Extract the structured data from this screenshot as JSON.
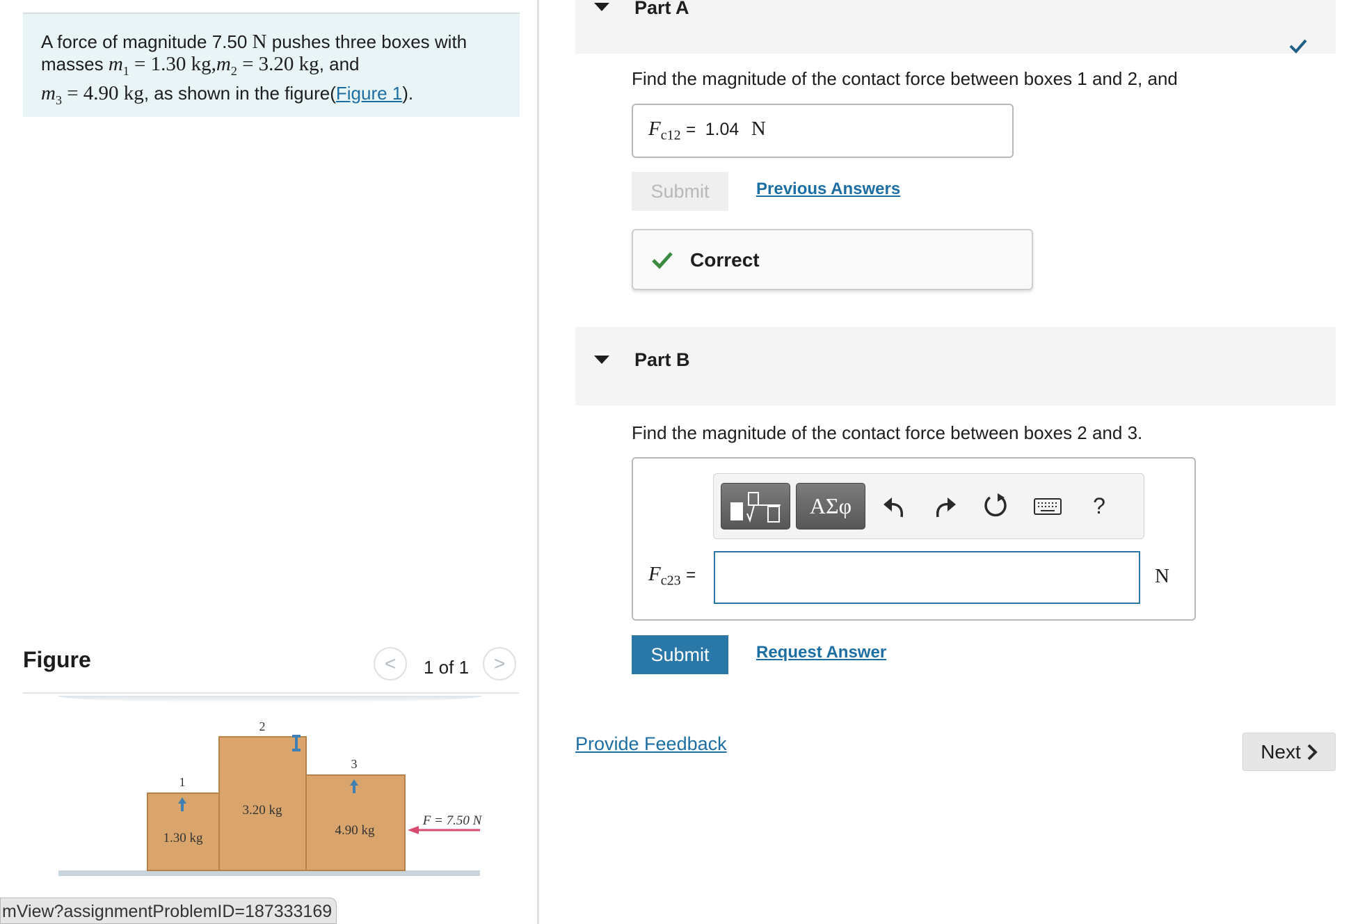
{
  "problem": {
    "text_1": "A force of magnitude 7.50",
    "force_unit": "N",
    "text_2": "pushes three boxes with",
    "masses_word": "masses",
    "m1_sym": "m",
    "m1_sub": "1",
    "m1_eq": "= 1.30  kg,",
    "m2_sym": "m",
    "m2_sub": "2",
    "m2_eq": "= 3.20 kg",
    "and_word": ", and",
    "m3_sym": "m",
    "m3_sub": "3",
    "m3_eq": "= 4.90 kg",
    "text_3": ", as shown in the figure(",
    "figure_link": "Figure 1",
    "text_4": ")."
  },
  "figure": {
    "title": "Figure",
    "pager": "1 of 1",
    "prev": "<",
    "next": ">",
    "box1_number": "1",
    "box1_mass": "1.30 kg",
    "box2_number": "2",
    "box2_mass": "3.20 kg",
    "box3_number": "3",
    "box3_mass": "4.90 kg",
    "force_label": "F = 7.50 N",
    "arrow_label": "UP"
  },
  "url_fragment": "mView?assignmentProblemID=187333169",
  "part_a": {
    "title": "Part A",
    "question": "Find the magnitude of the contact force between boxes 1 and 2, and",
    "var_symbol": "F",
    "var_sub": "c12",
    "equals": "=",
    "value": "1.04",
    "unit": "N",
    "submit": "Submit",
    "previous_answers": "Previous Answers",
    "feedback": "Correct"
  },
  "part_b": {
    "title": "Part B",
    "question": "Find the magnitude of the contact force between boxes 2 and 3.",
    "var_symbol": "F",
    "var_sub": "c23",
    "equals": "=",
    "unit": "N",
    "input_value": "",
    "greek_label": "ΑΣφ",
    "help_label": "?",
    "submit": "Submit",
    "request_answer": "Request Answer"
  },
  "provide_feedback": "Provide Feedback",
  "next_button": "Next",
  "colors": {
    "accent": "#2a78a8",
    "link": "#1d6fa3",
    "correct_green": "#3a8a3f",
    "box_fill": "#d9a56c",
    "force_arrow": "#d94a6e"
  }
}
